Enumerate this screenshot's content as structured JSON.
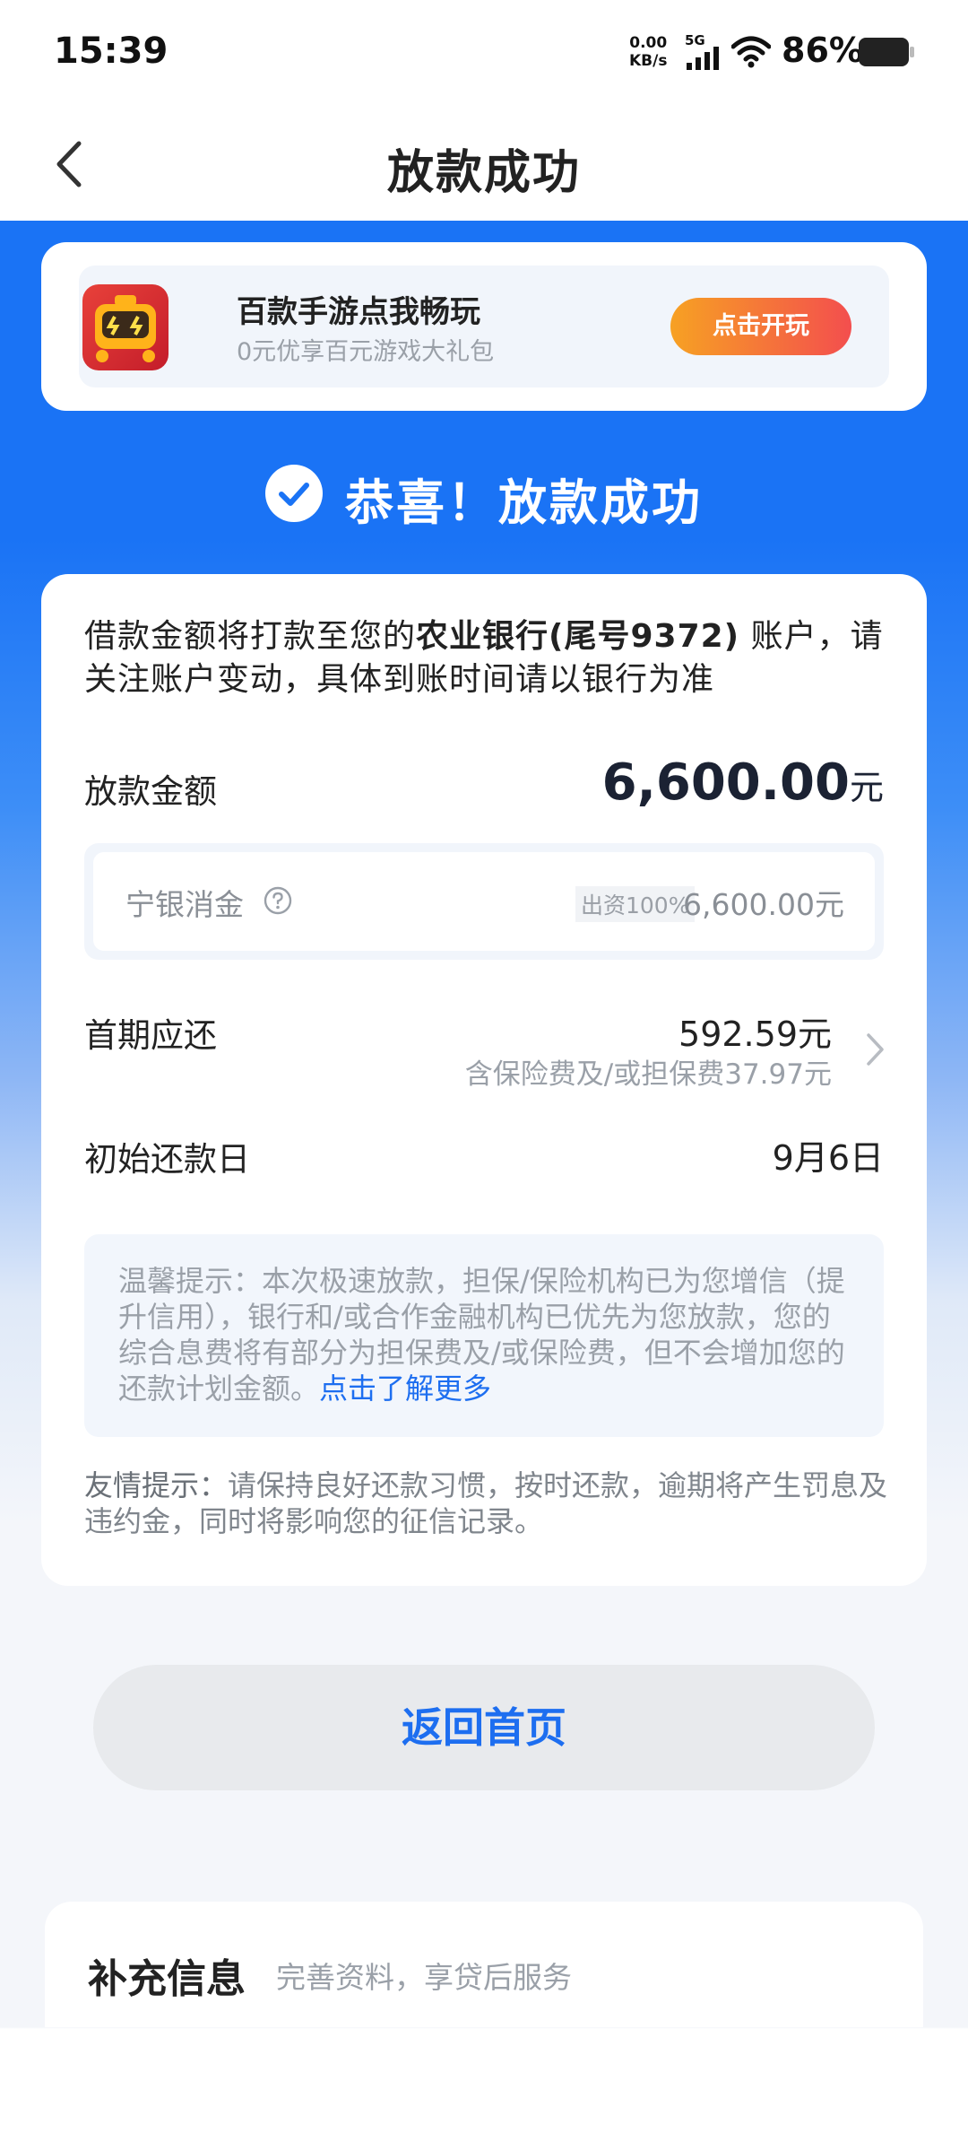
{
  "status_bar": {
    "time": "15:39",
    "net_speed_value": "0.00",
    "net_speed_unit": "KB/s",
    "network_type": "5G",
    "battery": "86%"
  },
  "header": {
    "title": "放款成功"
  },
  "ad_banner": {
    "title": "百款手游点我畅玩",
    "subtitle": "0元优享百元游戏大礼包",
    "button_label": "点击开玩"
  },
  "success": {
    "message": "恭喜！放款成功"
  },
  "loan": {
    "notice_prefix": "借款金额将打款至您的",
    "notice_bank": "农业银行(尾号9372)",
    "notice_suffix": "账户，请关注账户变动，具体到账时间请以银行为准",
    "amount_label": "放款金额",
    "amount_value": "6,600.00",
    "amount_unit": "元",
    "funder_name": "宁银消金",
    "funder_share": "出资100%",
    "funder_amount": "6,600.00元",
    "first_payment_label": "首期应还",
    "first_payment_value": "592.59元",
    "first_payment_note": "含保险费及/或担保费37.97元",
    "start_date_label": "初始还款日",
    "start_date_value": "9月6日",
    "tip_text": "温馨提示：本次极速放款，担保/保险机构已为您增信（提升信用），银行和/或合作金融机构已优先为您放款，您的综合息费将有部分为担保费及/或保险费，但不会增加您的还款计划金额。",
    "tip_link": "点击了解更多",
    "friendly_label": "友情提示：",
    "friendly_text": "请保持良好还款习惯，按时还款，逾期将产生罚息及违约金，同时将影响您的征信记录。"
  },
  "actions": {
    "home_button": "返回首页"
  },
  "supplementary": {
    "title": "补充信息",
    "subtitle": "完善资料，享贷后服务"
  },
  "colors": {
    "primary_blue": "#1a73f5",
    "link_blue": "#1d6ef0",
    "ad_button_start": "#f7a123",
    "ad_button_end": "#f34e4e"
  }
}
